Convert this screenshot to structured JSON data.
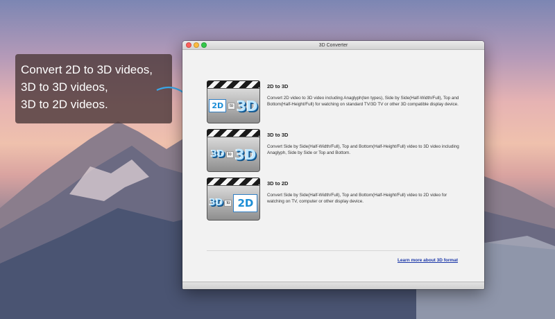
{
  "callout": {
    "lines": [
      "Convert 2D to 3D videos,",
      "3D to 3D videos,",
      "3D to 2D videos."
    ]
  },
  "window": {
    "title": "3D Converter"
  },
  "items": [
    {
      "title": "2D to 3D",
      "description": "Convert 2D video to 3D video including Anaglyph(ten types), Side by Side(Half-Width/Full), Top and Bottom(Half-Height/Full) for watching on standard TV/3D TV or other 3D compatible display device.",
      "thumb_left": "2D",
      "thumb_mid": "to",
      "thumb_right": "3D"
    },
    {
      "title": "3D to 3D",
      "description": "Convert Side by Side(Half-Width/Full), Top and Bottom(Half-Height/Full) video to 3D video including Anaglyph, Side by Side or Top and Bottom.",
      "thumb_left": "3D",
      "thumb_mid": "to",
      "thumb_right": "3D"
    },
    {
      "title": "3D to 2D",
      "description": "Convert Side by Side(Half-Width/Full), Top and Bottom(Half-Height/Full) video to 2D video for watching on TV, computer or other display device.",
      "thumb_left": "3D",
      "thumb_mid": "to",
      "thumb_right": "2D"
    }
  ],
  "footer": {
    "learn_more": "Learn more about 3D format"
  },
  "colors": {
    "callout_bg": "#4e3a3c",
    "link": "#1a36a8",
    "accent_blue": "#1c8ed6",
    "close": "#fc605c",
    "minimize": "#fdbc40",
    "maximize": "#34c84a"
  },
  "icons": [
    "close-icon",
    "minimize-icon",
    "maximize-icon",
    "clapperboard-icon",
    "curved-arrow-icon"
  ]
}
